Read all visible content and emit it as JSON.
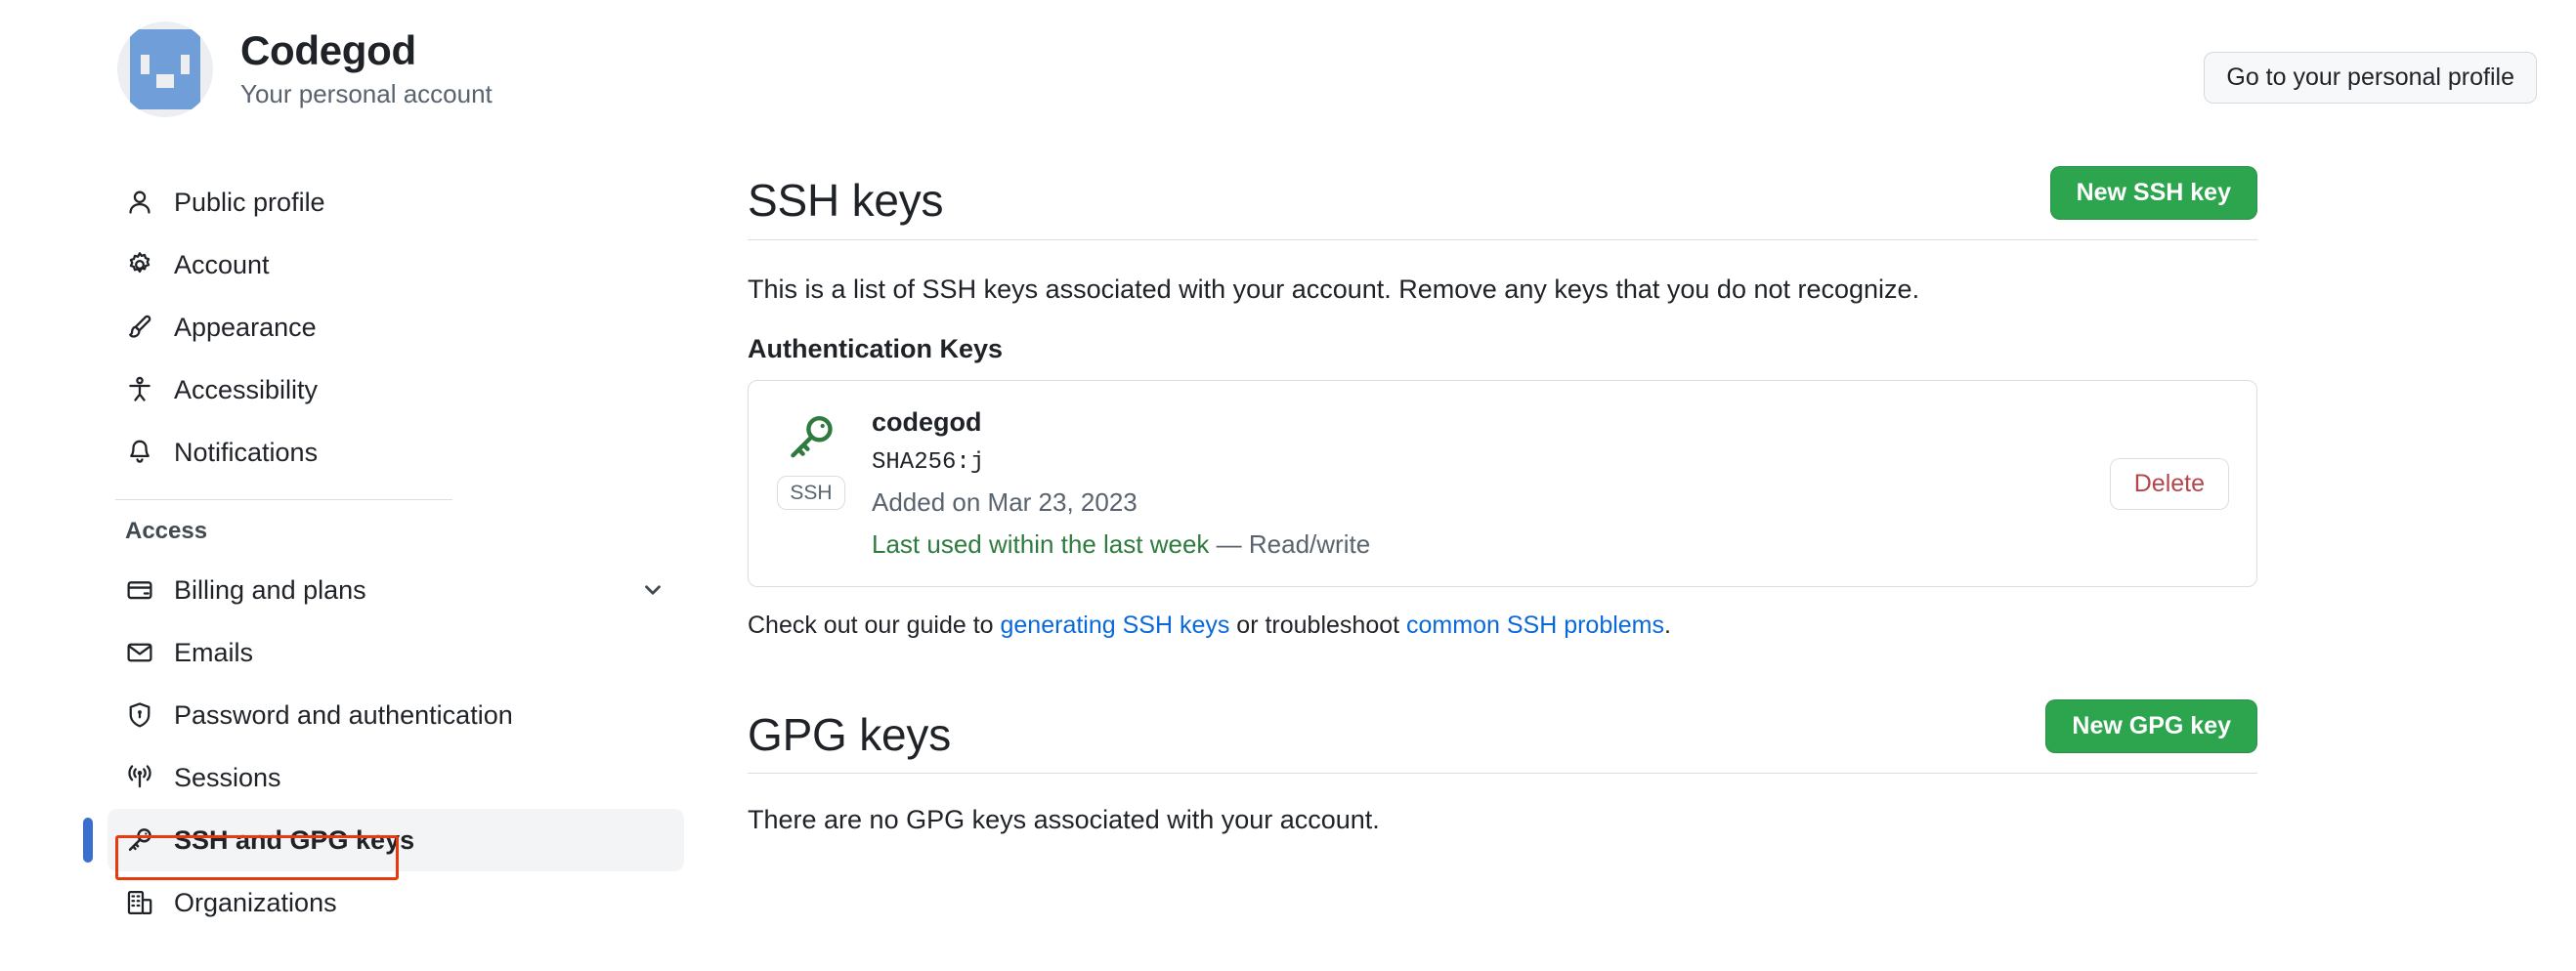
{
  "header": {
    "account_name": "Codegod",
    "account_subtitle": "Your personal account",
    "profile_button": "Go to your personal profile"
  },
  "sidebar": {
    "primary_items": [
      {
        "label": "Public profile",
        "icon": "person-icon"
      },
      {
        "label": "Account",
        "icon": "gear-icon"
      },
      {
        "label": "Appearance",
        "icon": "paintbrush-icon"
      },
      {
        "label": "Accessibility",
        "icon": "accessibility-icon"
      },
      {
        "label": "Notifications",
        "icon": "bell-icon"
      }
    ],
    "section_title": "Access",
    "access_items": [
      {
        "label": "Billing and plans",
        "icon": "credit-card-icon",
        "has_chevron": true
      },
      {
        "label": "Emails",
        "icon": "mail-icon",
        "has_chevron": false
      },
      {
        "label": "Password and authentication",
        "icon": "shield-lock-icon",
        "has_chevron": false
      },
      {
        "label": "Sessions",
        "icon": "broadcast-icon",
        "has_chevron": false
      },
      {
        "label": "SSH and GPG keys",
        "icon": "key-icon",
        "has_chevron": false,
        "selected": true
      },
      {
        "label": "Organizations",
        "icon": "organization-icon",
        "has_chevron": false
      }
    ]
  },
  "ssh_section": {
    "title": "SSH keys",
    "new_key_button": "New SSH key",
    "description": "This is a list of SSH keys associated with your account. Remove any keys that you do not recognize.",
    "subhead": "Authentication Keys",
    "key": {
      "name": "codegod",
      "fingerprint": "SHA256:j",
      "badge": "SSH",
      "added": "Added on Mar 23, 2023",
      "last_used": "Last used within the last week",
      "permission": "— Read/write",
      "delete_button": "Delete"
    },
    "guide": {
      "prefix": "Check out our guide to ",
      "link1": "generating SSH keys",
      "middle": " or troubleshoot ",
      "link2": "common SSH problems",
      "suffix": "."
    }
  },
  "gpg_section": {
    "title": "GPG keys",
    "new_key_button": "New GPG key",
    "empty_text": "There are no GPG keys associated with your account."
  },
  "colors": {
    "green_button": "#2da44e",
    "link_blue": "#0969da",
    "delete_red": "#b5454a",
    "highlight_red": "#e8390f",
    "selected_accent": "#3a6fd0",
    "key_green": "#2f7a3e"
  }
}
